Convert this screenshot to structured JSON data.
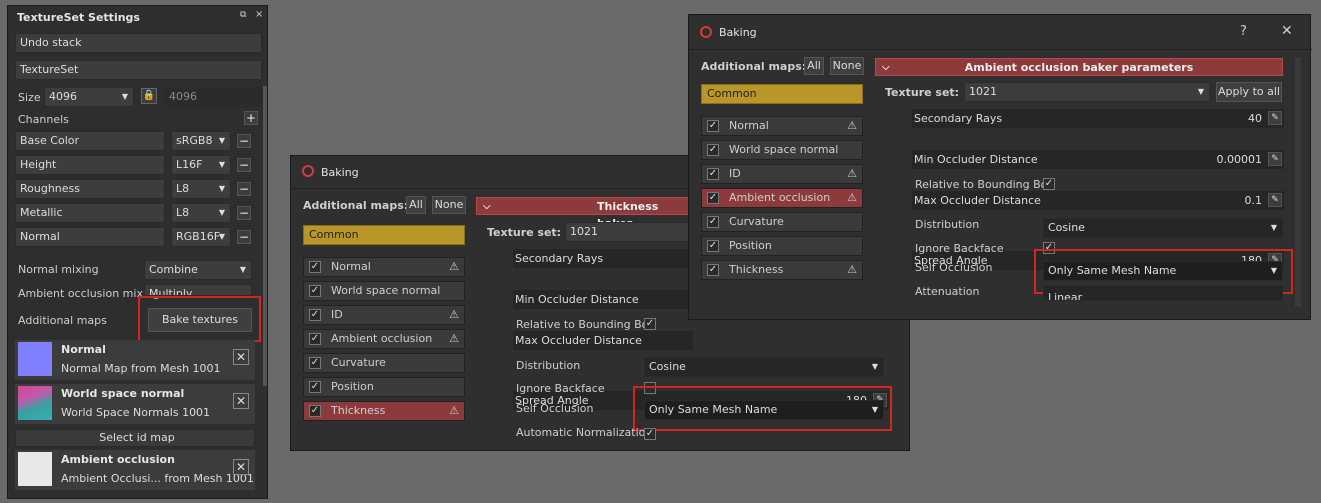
{
  "textureset_panel": {
    "title": "TextureSet Settings",
    "undo_stack": "Undo stack",
    "textureset": "TextureSet",
    "size_label": "Size",
    "size_value": "4096",
    "size_value2": "4096",
    "channels_label": "Channels",
    "channels": [
      {
        "name": "Base Color",
        "format": "sRGB8"
      },
      {
        "name": "Height",
        "format": "L16F"
      },
      {
        "name": "Roughness",
        "format": "L8"
      },
      {
        "name": "Metallic",
        "format": "L8"
      },
      {
        "name": "Normal",
        "format": "RGB16F"
      }
    ],
    "normal_mixing_label": "Normal mixing",
    "normal_mixing_value": "Combine",
    "ao_mixing_label": "Ambient occlusion mixing",
    "ao_mixing_value": "Multiply",
    "additional_maps_label": "Additional maps",
    "bake_button": "Bake textures",
    "maps": [
      {
        "name": "Normal",
        "sub": "Normal Map from Mesh 1001"
      },
      {
        "name": "World space normal",
        "sub": "World Space Normals 1001"
      },
      {
        "name": "Ambient occlusion",
        "sub": "Ambient Occlusi... from Mesh 1001"
      }
    ],
    "select_id_map": "Select id map"
  },
  "baking_back": {
    "title": "Baking",
    "additional_maps": "Additional maps:",
    "all": "All",
    "none": "None",
    "common": "Common",
    "items": [
      {
        "label": "Normal",
        "warn": true
      },
      {
        "label": "World space normal",
        "warn": false
      },
      {
        "label": "ID",
        "warn": true
      },
      {
        "label": "Ambient occlusion",
        "warn": true
      },
      {
        "label": "Curvature",
        "warn": false
      },
      {
        "label": "Position",
        "warn": false
      },
      {
        "label": "Thickness",
        "warn": true
      }
    ],
    "header": "Thickness baker",
    "texture_set_label": "Texture set:",
    "texture_set_value": "1021",
    "secondary_rays": "Secondary Rays",
    "min_occluder": "Min Occluder Distance",
    "max_occluder": "Max Occluder Distance",
    "relative_bbox": "Relative to Bounding Box",
    "spread_angle": "Spread Angle",
    "spread_value": "180",
    "distribution_label": "Distribution",
    "distribution_value": "Cosine",
    "ignore_backface": "Ignore Backface",
    "self_occlusion_label": "Self Occlusion",
    "self_occlusion_value": "Only Same Mesh Name",
    "auto_norm": "Automatic Normalization"
  },
  "baking_front": {
    "title": "Baking",
    "help": "?",
    "close": "✕",
    "additional_maps": "Additional maps:",
    "all": "All",
    "none": "None",
    "common": "Common",
    "items": [
      {
        "label": "Normal",
        "warn": true
      },
      {
        "label": "World space normal",
        "warn": false
      },
      {
        "label": "ID",
        "warn": true
      },
      {
        "label": "Ambient occlusion",
        "warn": true
      },
      {
        "label": "Curvature",
        "warn": false
      },
      {
        "label": "Position",
        "warn": false
      },
      {
        "label": "Thickness",
        "warn": true
      }
    ],
    "header": "Ambient occlusion baker parameters",
    "texture_set_label": "Texture set:",
    "texture_set_value": "1021",
    "apply_all": "Apply to all",
    "secondary_rays": "Secondary Rays",
    "secondary_rays_value": "40",
    "min_occluder": "Min Occluder Distance",
    "min_occluder_value": "0.00001",
    "max_occluder": "Max Occluder Distance",
    "max_occluder_value": "0.1",
    "relative_bbox": "Relative to Bounding Box",
    "spread_angle": "Spread Angle",
    "spread_value": "180",
    "distribution_label": "Distribution",
    "distribution_value": "Cosine",
    "ignore_backface": "Ignore Backface",
    "self_occlusion_label": "Self Occlusion",
    "self_occlusion_value": "Only Same Mesh Name",
    "attenuation_label": "Attenuation",
    "attenuation_value": "Linear"
  }
}
